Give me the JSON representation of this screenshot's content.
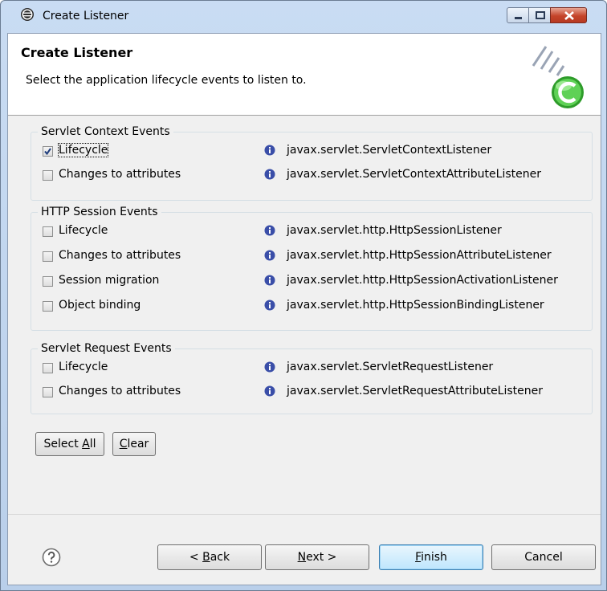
{
  "window": {
    "title": "Create Listener"
  },
  "banner": {
    "title": "Create Listener",
    "description": "Select the application lifecycle events to listen to."
  },
  "groups": [
    {
      "legend": "Servlet Context Events",
      "items": [
        {
          "label": "Lifecycle",
          "checked": true,
          "interface": "javax.servlet.ServletContextListener"
        },
        {
          "label": "Changes to attributes",
          "checked": false,
          "interface": "javax.servlet.ServletContextAttributeListener"
        }
      ]
    },
    {
      "legend": "HTTP Session Events",
      "items": [
        {
          "label": "Lifecycle",
          "checked": false,
          "interface": "javax.servlet.http.HttpSessionListener"
        },
        {
          "label": "Changes to attributes",
          "checked": false,
          "interface": "javax.servlet.http.HttpSessionAttributeListener"
        },
        {
          "label": "Session migration",
          "checked": false,
          "interface": "javax.servlet.http.HttpSessionActivationListener"
        },
        {
          "label": "Object binding",
          "checked": false,
          "interface": "javax.servlet.http.HttpSessionBindingListener"
        }
      ]
    },
    {
      "legend": "Servlet Request Events",
      "items": [
        {
          "label": "Lifecycle",
          "checked": false,
          "interface": "javax.servlet.ServletRequestListener"
        },
        {
          "label": "Changes to attributes",
          "checked": false,
          "interface": "javax.servlet.ServletRequestAttributeListener"
        }
      ]
    }
  ],
  "selection": {
    "select_all_prefix": "Select ",
    "select_all_mnemonic": "A",
    "select_all_suffix": "ll",
    "clear_mnemonic": "C",
    "clear_suffix": "lear"
  },
  "footer": {
    "back_prefix": "< ",
    "back_mnemonic": "B",
    "back_suffix": "ack",
    "next_mnemonic": "N",
    "next_suffix": "ext >",
    "finish_mnemonic": "F",
    "finish_suffix": "inish",
    "cancel_label": "Cancel"
  },
  "icons": {
    "app": "eclipse-icon",
    "info": "info-icon",
    "help": "help-icon",
    "banner": "class-wizard-icon"
  },
  "colors": {
    "info_blue": "#3a4ea8",
    "banner_green": "#4fc24a",
    "focus_blue": "#3c7fb1"
  }
}
